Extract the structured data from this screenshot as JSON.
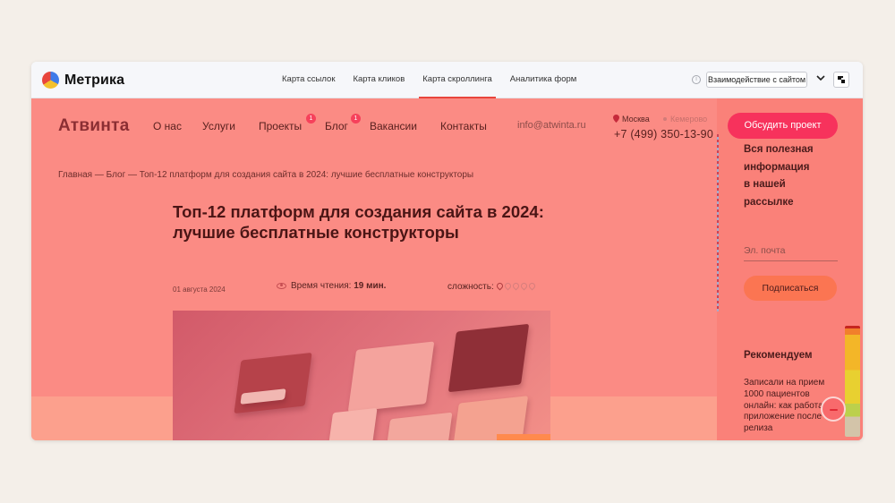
{
  "toolbar": {
    "logo_text": "Метрика",
    "tabs": [
      {
        "label": "Карта ссылок",
        "active": false
      },
      {
        "label": "Карта кликов",
        "active": false
      },
      {
        "label": "Карта скроллинга",
        "active": true
      },
      {
        "label": "Аналитика форм",
        "active": false
      }
    ],
    "interact_label": "Взаимодействие с сайтом",
    "info_glyph": "i",
    "active_tab_color": "#e8453c"
  },
  "site": {
    "brand": "Атвинта",
    "nav": [
      {
        "label": "О нас",
        "badge": null
      },
      {
        "label": "Услуги",
        "badge": null
      },
      {
        "label": "Проекты",
        "badge": "1"
      },
      {
        "label": "Блог",
        "badge": "1"
      },
      {
        "label": "Вакансии",
        "badge": null
      },
      {
        "label": "Контакты",
        "badge": null
      }
    ],
    "email": "info@atwinta.ru",
    "cities": [
      {
        "name": "Москва",
        "active": true
      },
      {
        "name": "Кемерово",
        "active": false
      }
    ],
    "phone": "+7 (499) 350-13-90",
    "discuss_button": "Обсудить проект",
    "breadcrumb": {
      "home": "Главная",
      "sep1": " — ",
      "blog": "Блог",
      "sep2": " — ",
      "current": "Топ-12 платформ для создания сайта в 2024: лучшие бесплатные конструкторы"
    },
    "article": {
      "title": "Топ-12 платформ для создания сайта в 2024: лучшие бесплатные конструкторы",
      "date": "01 августа 2024",
      "read_time_label": "Время чтения:",
      "read_time_value": "19 мин.",
      "difficulty_label": "сложность:",
      "difficulty_level": 1,
      "difficulty_max": 5
    },
    "sidebar": {
      "newsletter_lines": [
        "Вся полезная",
        "информация",
        "в нашей",
        "рассылке"
      ],
      "email_placeholder": "Эл. почта",
      "subscribe_button": "Подписаться",
      "recommend_title": "Рекомендуем",
      "recommend_link": "Записали на прием 1000 пациентов онлайн: как работает приложение после релиза"
    }
  },
  "colors": {
    "heat_primary": "#fb8b84",
    "heat_bottom": "#fca08d",
    "accent_pink": "#f7325c",
    "subscribe_orange": "#fb7552"
  },
  "icons": [
    "info-icon",
    "chevron-down-icon",
    "heatmap-toggle-icon",
    "location-pin-icon",
    "eye-icon",
    "difficulty-pin-icon"
  ]
}
